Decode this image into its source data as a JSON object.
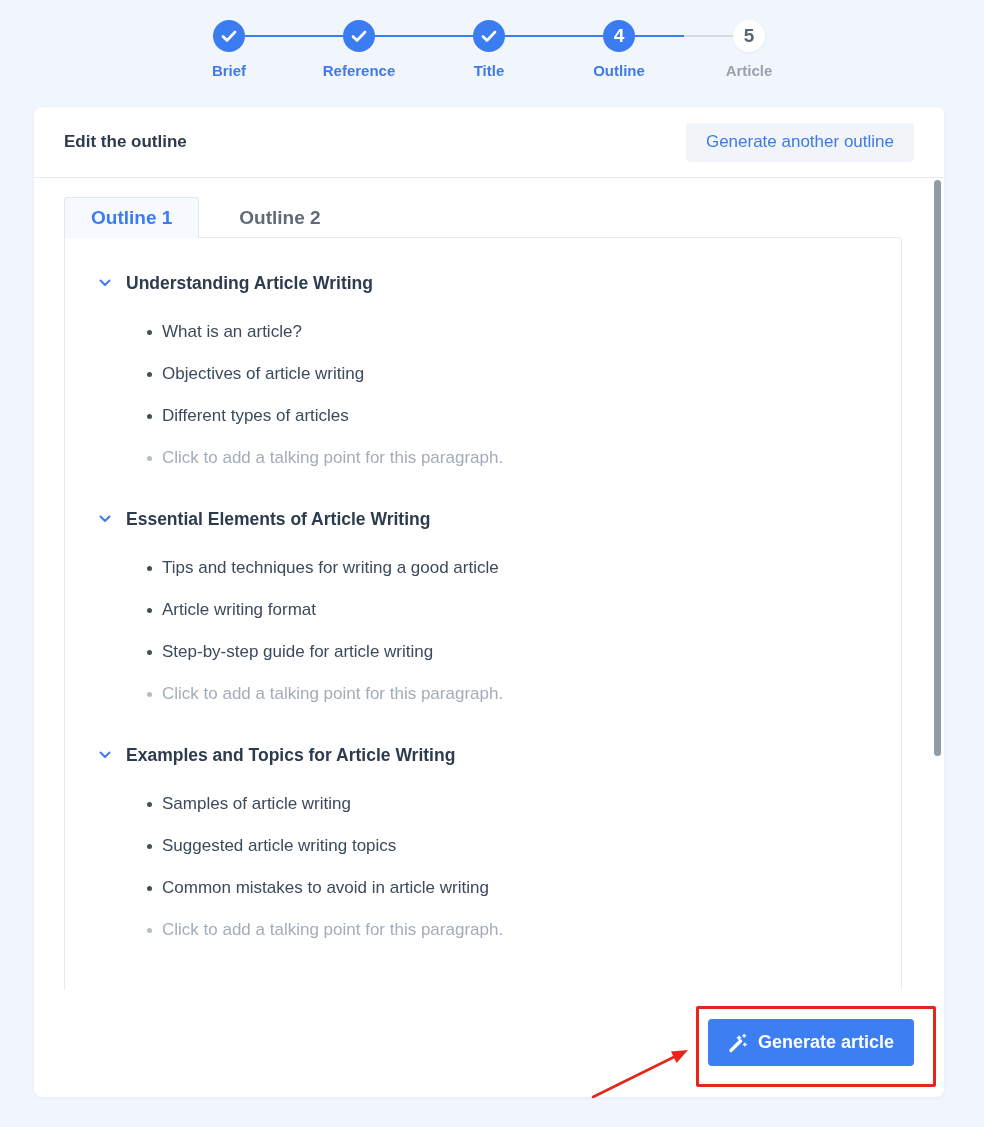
{
  "stepper": {
    "steps": [
      {
        "label": "Brief",
        "completed": true,
        "selected": false
      },
      {
        "label": "Reference",
        "completed": true,
        "selected": false
      },
      {
        "label": "Title",
        "completed": true,
        "selected": false
      },
      {
        "number": "4",
        "label": "Outline",
        "completed": false,
        "selected": true
      },
      {
        "number": "5",
        "label": "Article",
        "completed": false,
        "selected": false
      }
    ]
  },
  "card": {
    "title": "Edit the outline",
    "header_button": "Generate another outline",
    "tabs": [
      {
        "label": "Outline 1",
        "selected": true
      },
      {
        "label": "Outline 2",
        "selected": false
      }
    ],
    "sections": [
      {
        "heading": "Understanding Article Writing",
        "expanded": true,
        "points": [
          "What is an article?",
          "Objectives of article writing",
          "Different types of articles"
        ],
        "placeholder": "Click to add a talking point for this paragraph."
      },
      {
        "heading": "Essential Elements of Article Writing",
        "expanded": true,
        "points": [
          "Tips and techniques for writing a good article",
          "Article writing format",
          "Step-by-step guide for article writing"
        ],
        "placeholder": "Click to add a talking point for this paragraph."
      },
      {
        "heading": "Examples and Topics for Article Writing",
        "expanded": true,
        "points": [
          "Samples of article writing",
          "Suggested article writing topics",
          "Common mistakes to avoid in article writing"
        ],
        "placeholder": "Click to add a talking point for this paragraph."
      }
    ],
    "footer_button": "Generate article"
  },
  "annotation": {
    "frame": true,
    "arrow": true
  }
}
